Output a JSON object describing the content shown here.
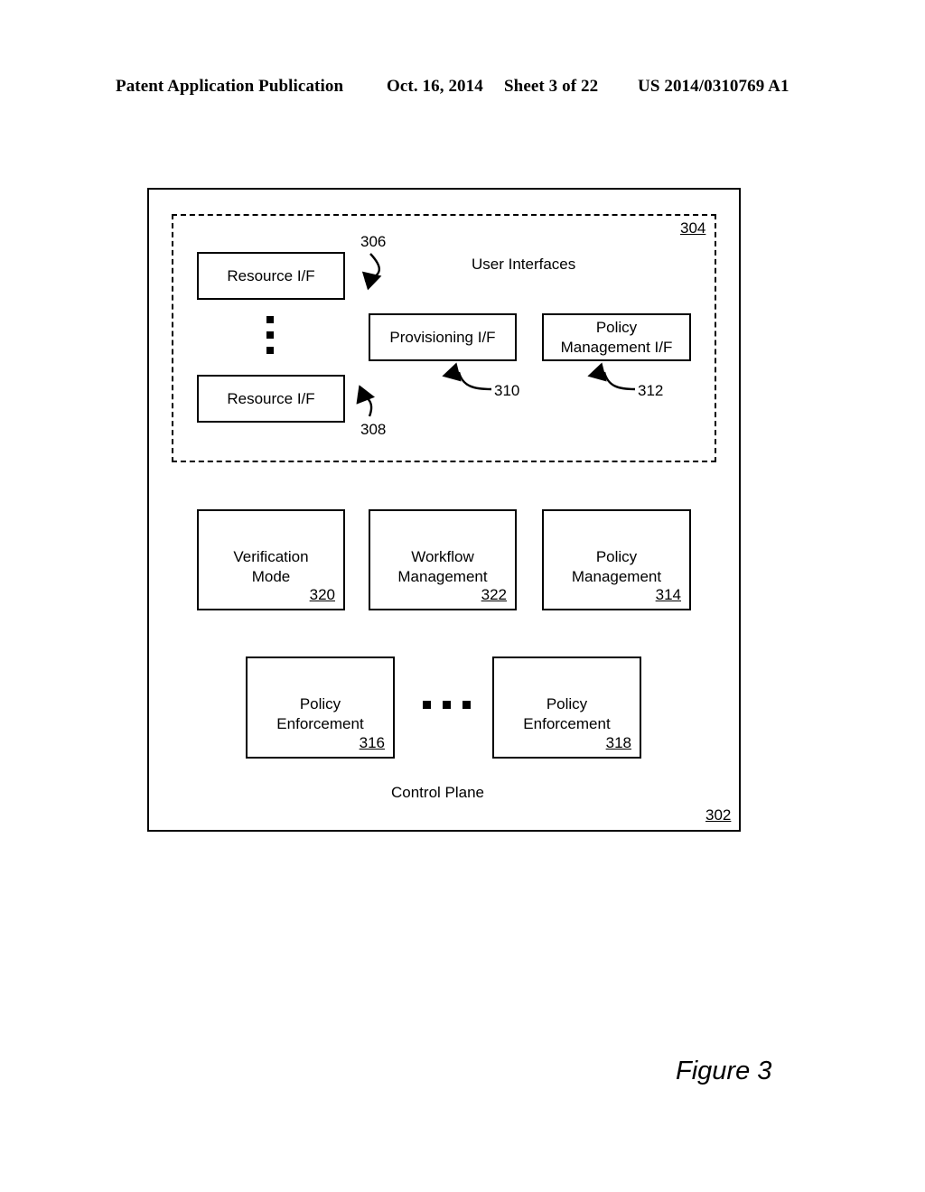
{
  "header": {
    "publication": "Patent Application Publication",
    "date": "Oct. 16, 2014",
    "sheet": "Sheet 3 of 22",
    "patent_number": "US 2014/0310769 A1"
  },
  "figure": {
    "caption": "Figure 3"
  },
  "diagram": {
    "outer_region": {
      "label": "Control Plane",
      "ref": "302"
    },
    "dashed_region": {
      "label": "User Interfaces",
      "ref": "304"
    },
    "interface_blocks": [
      {
        "label": "Resource I/F",
        "ref": "306"
      },
      {
        "label": "Resource I/F",
        "ref": "308"
      },
      {
        "label": "Provisioning I/F",
        "ref": "310"
      },
      {
        "label": "Policy\nManagement I/F",
        "ref": "312"
      }
    ],
    "component_blocks": [
      {
        "label": "Verification\nMode",
        "ref": "320"
      },
      {
        "label": "Workflow\nManagement",
        "ref": "322"
      },
      {
        "label": "Policy\nManagement",
        "ref": "314"
      }
    ],
    "enforcement_blocks": [
      {
        "label": "Policy\nEnforcement",
        "ref": "316"
      },
      {
        "label": "Policy\nEnforcement",
        "ref": "318"
      }
    ],
    "colors": {
      "line": "#000000",
      "background": "#ffffff"
    }
  }
}
